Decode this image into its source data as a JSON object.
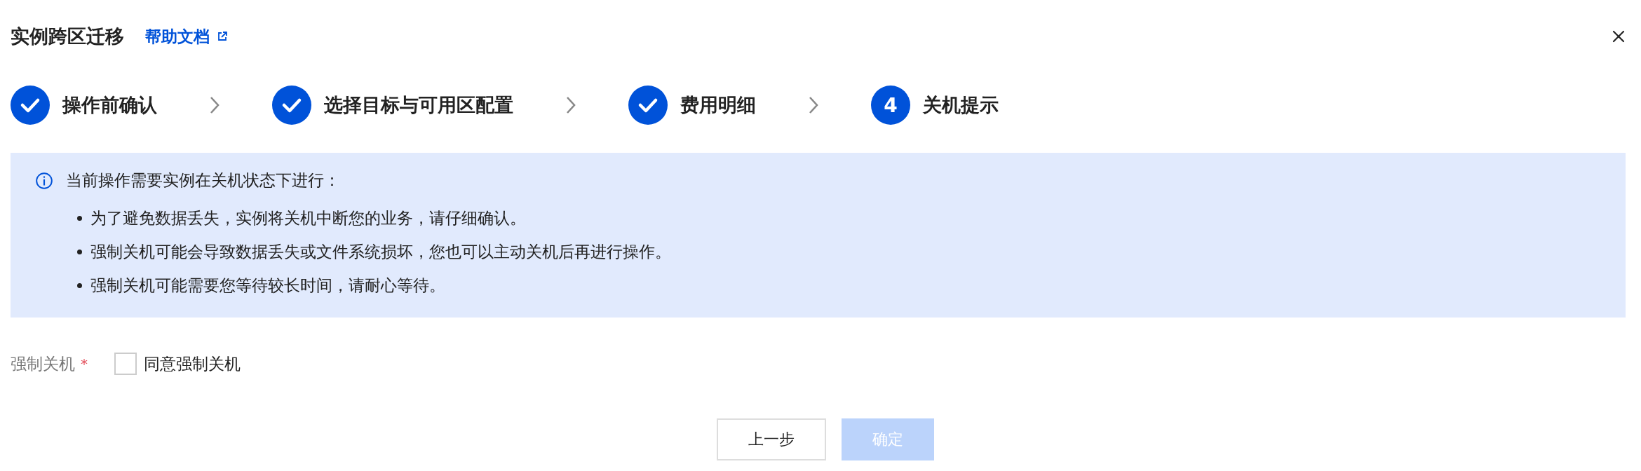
{
  "dialog": {
    "title": "实例跨区迁移",
    "help_link": "帮助文档"
  },
  "steps": [
    {
      "label": "操作前确认",
      "completed": true
    },
    {
      "label": "选择目标与可用区配置",
      "completed": true
    },
    {
      "label": "费用明细",
      "completed": true
    },
    {
      "number": "4",
      "label": "关机提示",
      "completed": false
    }
  ],
  "notice": {
    "heading": "当前操作需要实例在关机状态下进行：",
    "items": [
      "为了避免数据丢失，实例将关机中断您的业务，请仔细确认。",
      "强制关机可能会导致数据丢失或文件系统损坏，您也可以主动关机后再进行操作。",
      "强制关机可能需要您等待较长时间，请耐心等待。"
    ]
  },
  "form": {
    "label": "强制关机",
    "required_mark": "*",
    "checkbox": {
      "label": "同意强制关机",
      "checked": false
    }
  },
  "buttons": [
    {
      "label": "上一步",
      "kind": "secondary",
      "disabled": false
    },
    {
      "label": "确定",
      "kind": "primary",
      "disabled": true
    }
  ]
}
